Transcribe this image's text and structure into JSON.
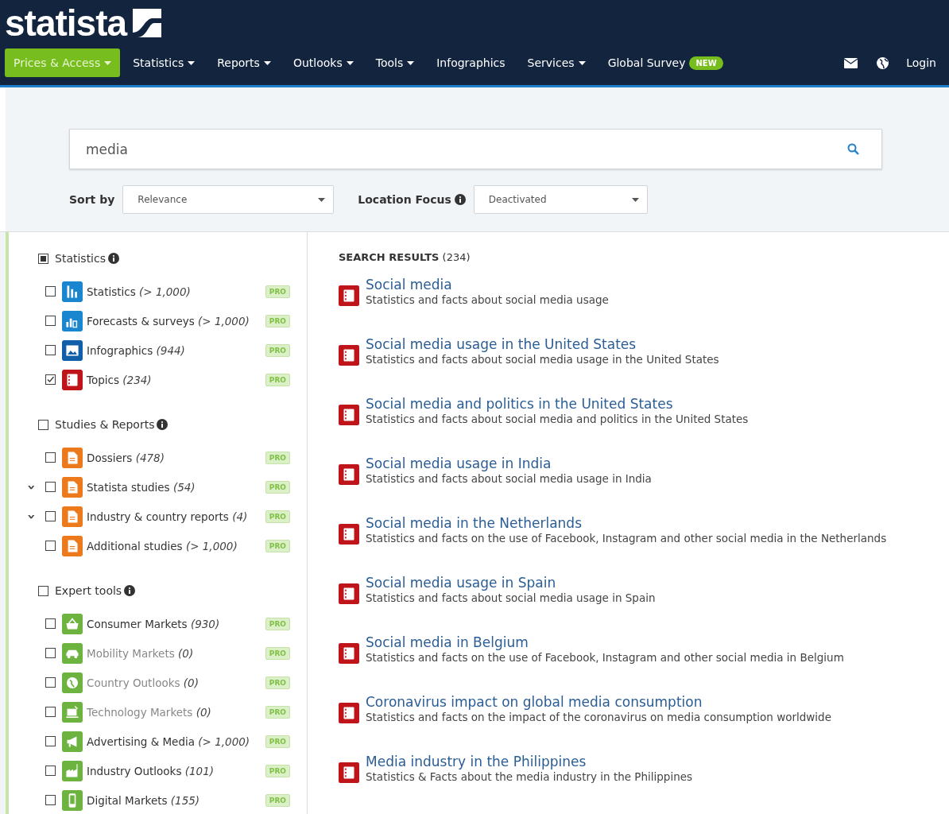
{
  "header": {
    "logo": "statista",
    "nav": [
      {
        "label": "Prices & Access",
        "dropdown": true,
        "selected": true
      },
      {
        "label": "Statistics",
        "dropdown": true,
        "selected": false
      },
      {
        "label": "Reports",
        "dropdown": true,
        "selected": false
      },
      {
        "label": "Outlooks",
        "dropdown": true,
        "selected": false
      },
      {
        "label": "Tools",
        "dropdown": true,
        "selected": false
      },
      {
        "label": "Infographics",
        "dropdown": false,
        "selected": false
      },
      {
        "label": "Services",
        "dropdown": true,
        "selected": false
      },
      {
        "label": "Global Survey",
        "dropdown": false,
        "selected": false,
        "badge": "NEW"
      }
    ],
    "login": "Login"
  },
  "search": {
    "value": "media"
  },
  "sort": {
    "label": "Sort by",
    "value": "Relevance"
  },
  "location": {
    "label": "Location Focus",
    "value": "Deactivated"
  },
  "filters": [
    {
      "label": "Statistics",
      "checked": false,
      "indeterminate": true,
      "items": [
        {
          "label": "Statistics",
          "count": "(> 1,000)",
          "kind": "bars",
          "color": "#1a86d0",
          "checked": false,
          "disabled": false,
          "badge": "PRO"
        },
        {
          "label": "Forecasts & surveys",
          "count": "(> 1,000)",
          "kind": "columns",
          "color": "#1a86d0",
          "checked": false,
          "disabled": false,
          "badge": "PRO"
        },
        {
          "label": "Infographics",
          "count": "(944)",
          "kind": "image",
          "color": "#115fa8",
          "checked": false,
          "disabled": false,
          "badge": "PRO"
        },
        {
          "label": "Topics",
          "count": "(234)",
          "kind": "topic",
          "color": "#c0141b",
          "checked": true,
          "disabled": false,
          "badge": "PRO"
        }
      ]
    },
    {
      "label": "Studies & Reports",
      "checked": false,
      "indeterminate": false,
      "items": [
        {
          "label": "Dossiers",
          "count": "(478)",
          "kind": "document",
          "color": "#ec7a1c",
          "checked": false,
          "disabled": false,
          "badge": "PRO"
        },
        {
          "label": "Statista studies",
          "count": "(54)",
          "kind": "document",
          "color": "#ec7a1c",
          "checked": false,
          "disabled": false,
          "toggle": "›",
          "badge": "PRO"
        },
        {
          "label": "Industry & country reports",
          "count": "(4)",
          "kind": "document",
          "color": "#ec7a1c",
          "checked": false,
          "disabled": false,
          "toggle": "›",
          "badge": "PRO"
        },
        {
          "label": "Additional studies",
          "count": "(> 1,000)",
          "kind": "document",
          "color": "#ec7a1c",
          "checked": false,
          "disabled": false,
          "badge": "PRO"
        }
      ]
    },
    {
      "label": "Expert tools",
      "checked": false,
      "indeterminate": false,
      "items": [
        {
          "label": "Consumer Markets",
          "count": "(930)",
          "kind": "basket",
          "color": "#6cb33f",
          "checked": false,
          "disabled": false,
          "badge": "PRO"
        },
        {
          "label": "Mobility Markets",
          "count": "(0)",
          "kind": "car",
          "color": "#6cb33f",
          "checked": false,
          "disabled": true,
          "badge": "PRO"
        },
        {
          "label": "Country Outlooks",
          "count": "(0)",
          "kind": "globe",
          "color": "#6cb33f",
          "checked": false,
          "disabled": true,
          "badge": "PRO"
        },
        {
          "label": "Technology Markets",
          "count": "(0)",
          "kind": "monitor",
          "color": "#6cb33f",
          "checked": false,
          "disabled": true,
          "badge": "PRO"
        },
        {
          "label": "Advertising & Media",
          "count": "(> 1,000)",
          "kind": "megaphone",
          "color": "#6cb33f",
          "checked": false,
          "disabled": false,
          "badge": "PRO"
        },
        {
          "label": "Industry Outlooks",
          "count": "(101)",
          "kind": "factory",
          "color": "#6cb33f",
          "checked": false,
          "disabled": false,
          "badge": "PRO"
        },
        {
          "label": "Digital Markets",
          "count": "(155)",
          "kind": "phone",
          "color": "#6cb33f",
          "checked": false,
          "disabled": false,
          "badge": "PRO"
        }
      ]
    }
  ],
  "results": {
    "heading": "SEARCH RESULTS",
    "count": "(234)",
    "items": [
      {
        "title": "Social media",
        "description": "Statistics and facts about social media usage"
      },
      {
        "title": "Social media usage in the United States",
        "description": "Statistics and facts about social media usage in the United States"
      },
      {
        "title": "Social media and politics in the United States",
        "description": "Statistics and facts about social media and politics in the United States"
      },
      {
        "title": "Social media usage in India",
        "description": "Statistics and facts about social media usage in India"
      },
      {
        "title": "Social media in the Netherlands",
        "description": "Statistics and facts on the use of Facebook, Instagram and other social media in the Netherlands"
      },
      {
        "title": "Social media usage in Spain",
        "description": "Statistics and facts about social media usage in Spain"
      },
      {
        "title": "Social media in Belgium",
        "description": "Statistics and facts on the use of Facebook, Instagram and other social media in Belgium"
      },
      {
        "title": "Coronavirus impact on global media consumption",
        "description": "Statistics and facts on the impact of the coronavirus on media consumption worldwide"
      },
      {
        "title": "Media industry in the Philippines",
        "description": "Statistics & Facts about the media industry in the Philippines"
      }
    ]
  }
}
